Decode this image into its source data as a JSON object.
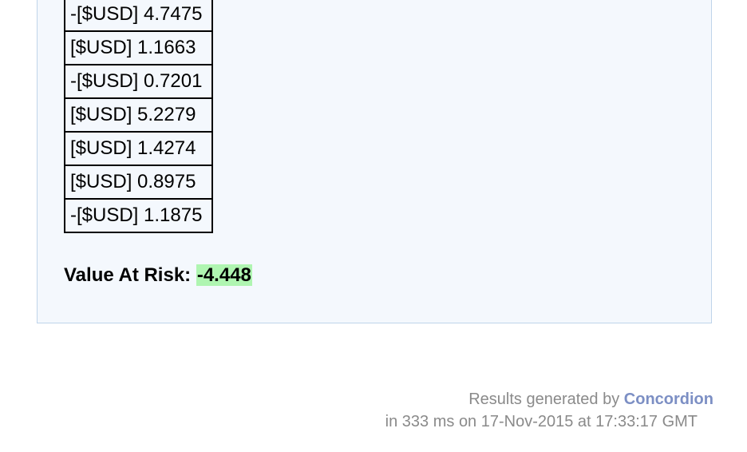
{
  "table": {
    "rows": [
      "-[$USD] 4.7475",
      "[$USD] 1.1663",
      "-[$USD] 0.7201",
      "[$USD] 5.2279",
      "[$USD] 1.4274",
      "[$USD] 0.8975",
      "-[$USD] 1.1875"
    ]
  },
  "result": {
    "label": "Value At Risk:",
    "value": "-4.448",
    "status_color": "#aff5b1"
  },
  "footer": {
    "prefix": "Results generated by",
    "link_text": "Concordion",
    "timing": "in 333 ms on 17-Nov-2015 at 17:33:17 GMT"
  }
}
